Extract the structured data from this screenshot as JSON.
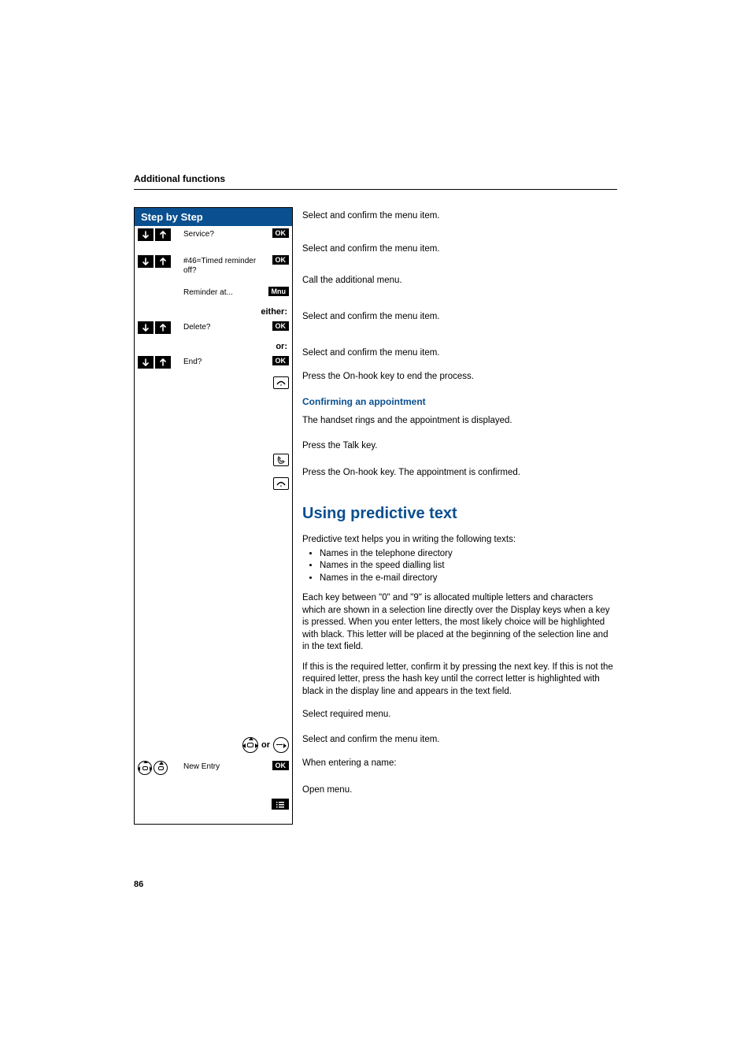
{
  "header": {
    "title": "Additional functions"
  },
  "stepByStep": {
    "title": "Step by Step",
    "rows": {
      "service": {
        "label": "Service?",
        "btn": "OK"
      },
      "timed_off": {
        "label": "#46=Timed reminder off?",
        "btn": "OK"
      },
      "reminder_at": {
        "label": "Reminder at...",
        "btn": "Mnu"
      },
      "either": "either:",
      "delete": {
        "label": "Delete?",
        "btn": "OK"
      },
      "or": "or:",
      "end": {
        "label": "End?",
        "btn": "OK"
      },
      "or2": "or",
      "new_entry": {
        "label": "New Entry",
        "btn": "OK"
      }
    }
  },
  "rightCol": {
    "r1": "Select and confirm the menu item.",
    "r2": "Select and confirm the menu item.",
    "r3": "Call the additional menu.",
    "r4": "Select and confirm the menu item.",
    "r5": "Select and confirm the menu item.",
    "r6": "Press the On-hook key to end the process.",
    "confirm_heading": "Confirming an appointment",
    "r7": "The handset rings and the appointment is displayed.",
    "r8": "Press the Talk key.",
    "r9": "Press the On-hook key. The appointment is confirmed.",
    "section_heading": "Using predictive text",
    "intro": "Predictive text helps you in writing the following texts:",
    "bullets": [
      "Names in the telephone directory",
      "Names in the speed dialling list",
      "Names in the e-mail directory"
    ],
    "para1": "Each key between \"0\" and \"9\" is allocated multiple letters and characters which are shown in a selection line directly over the Display keys when a key is pressed. When you enter letters, the most likely choice will be highlighted with black. This letter will be placed at the beginning of the selection line and in the text field.",
    "para2": "If this is the required letter, confirm it by pressing the next key. If this is not the required letter, press the hash key until the correct letter is highlighted with black in the display line and appears in the text field.",
    "r10": "Select required menu.",
    "r11": "Select and confirm the menu item.",
    "r12": "When entering a name:",
    "r13": "Open menu."
  },
  "pageNumber": "86"
}
